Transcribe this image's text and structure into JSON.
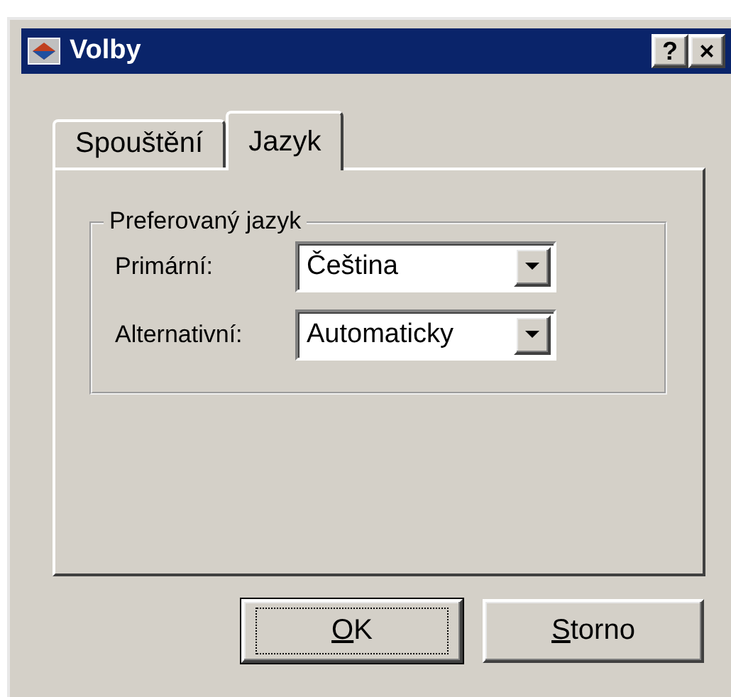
{
  "window": {
    "title": "Volby",
    "buttons": [
      "?",
      "×"
    ]
  },
  "tabs": [
    {
      "label": "Spouštění",
      "selected": false
    },
    {
      "label": "Jazyk",
      "selected": true
    }
  ],
  "group": {
    "title": "Preferovaný jazyk",
    "fields": [
      {
        "label": "Primární:",
        "value": "Čeština"
      },
      {
        "label": "Alternativní:",
        "value": "Automaticky"
      }
    ]
  },
  "buttons": [
    {
      "label": "OK",
      "default": true
    },
    {
      "label": "Storno",
      "default": false
    }
  ]
}
